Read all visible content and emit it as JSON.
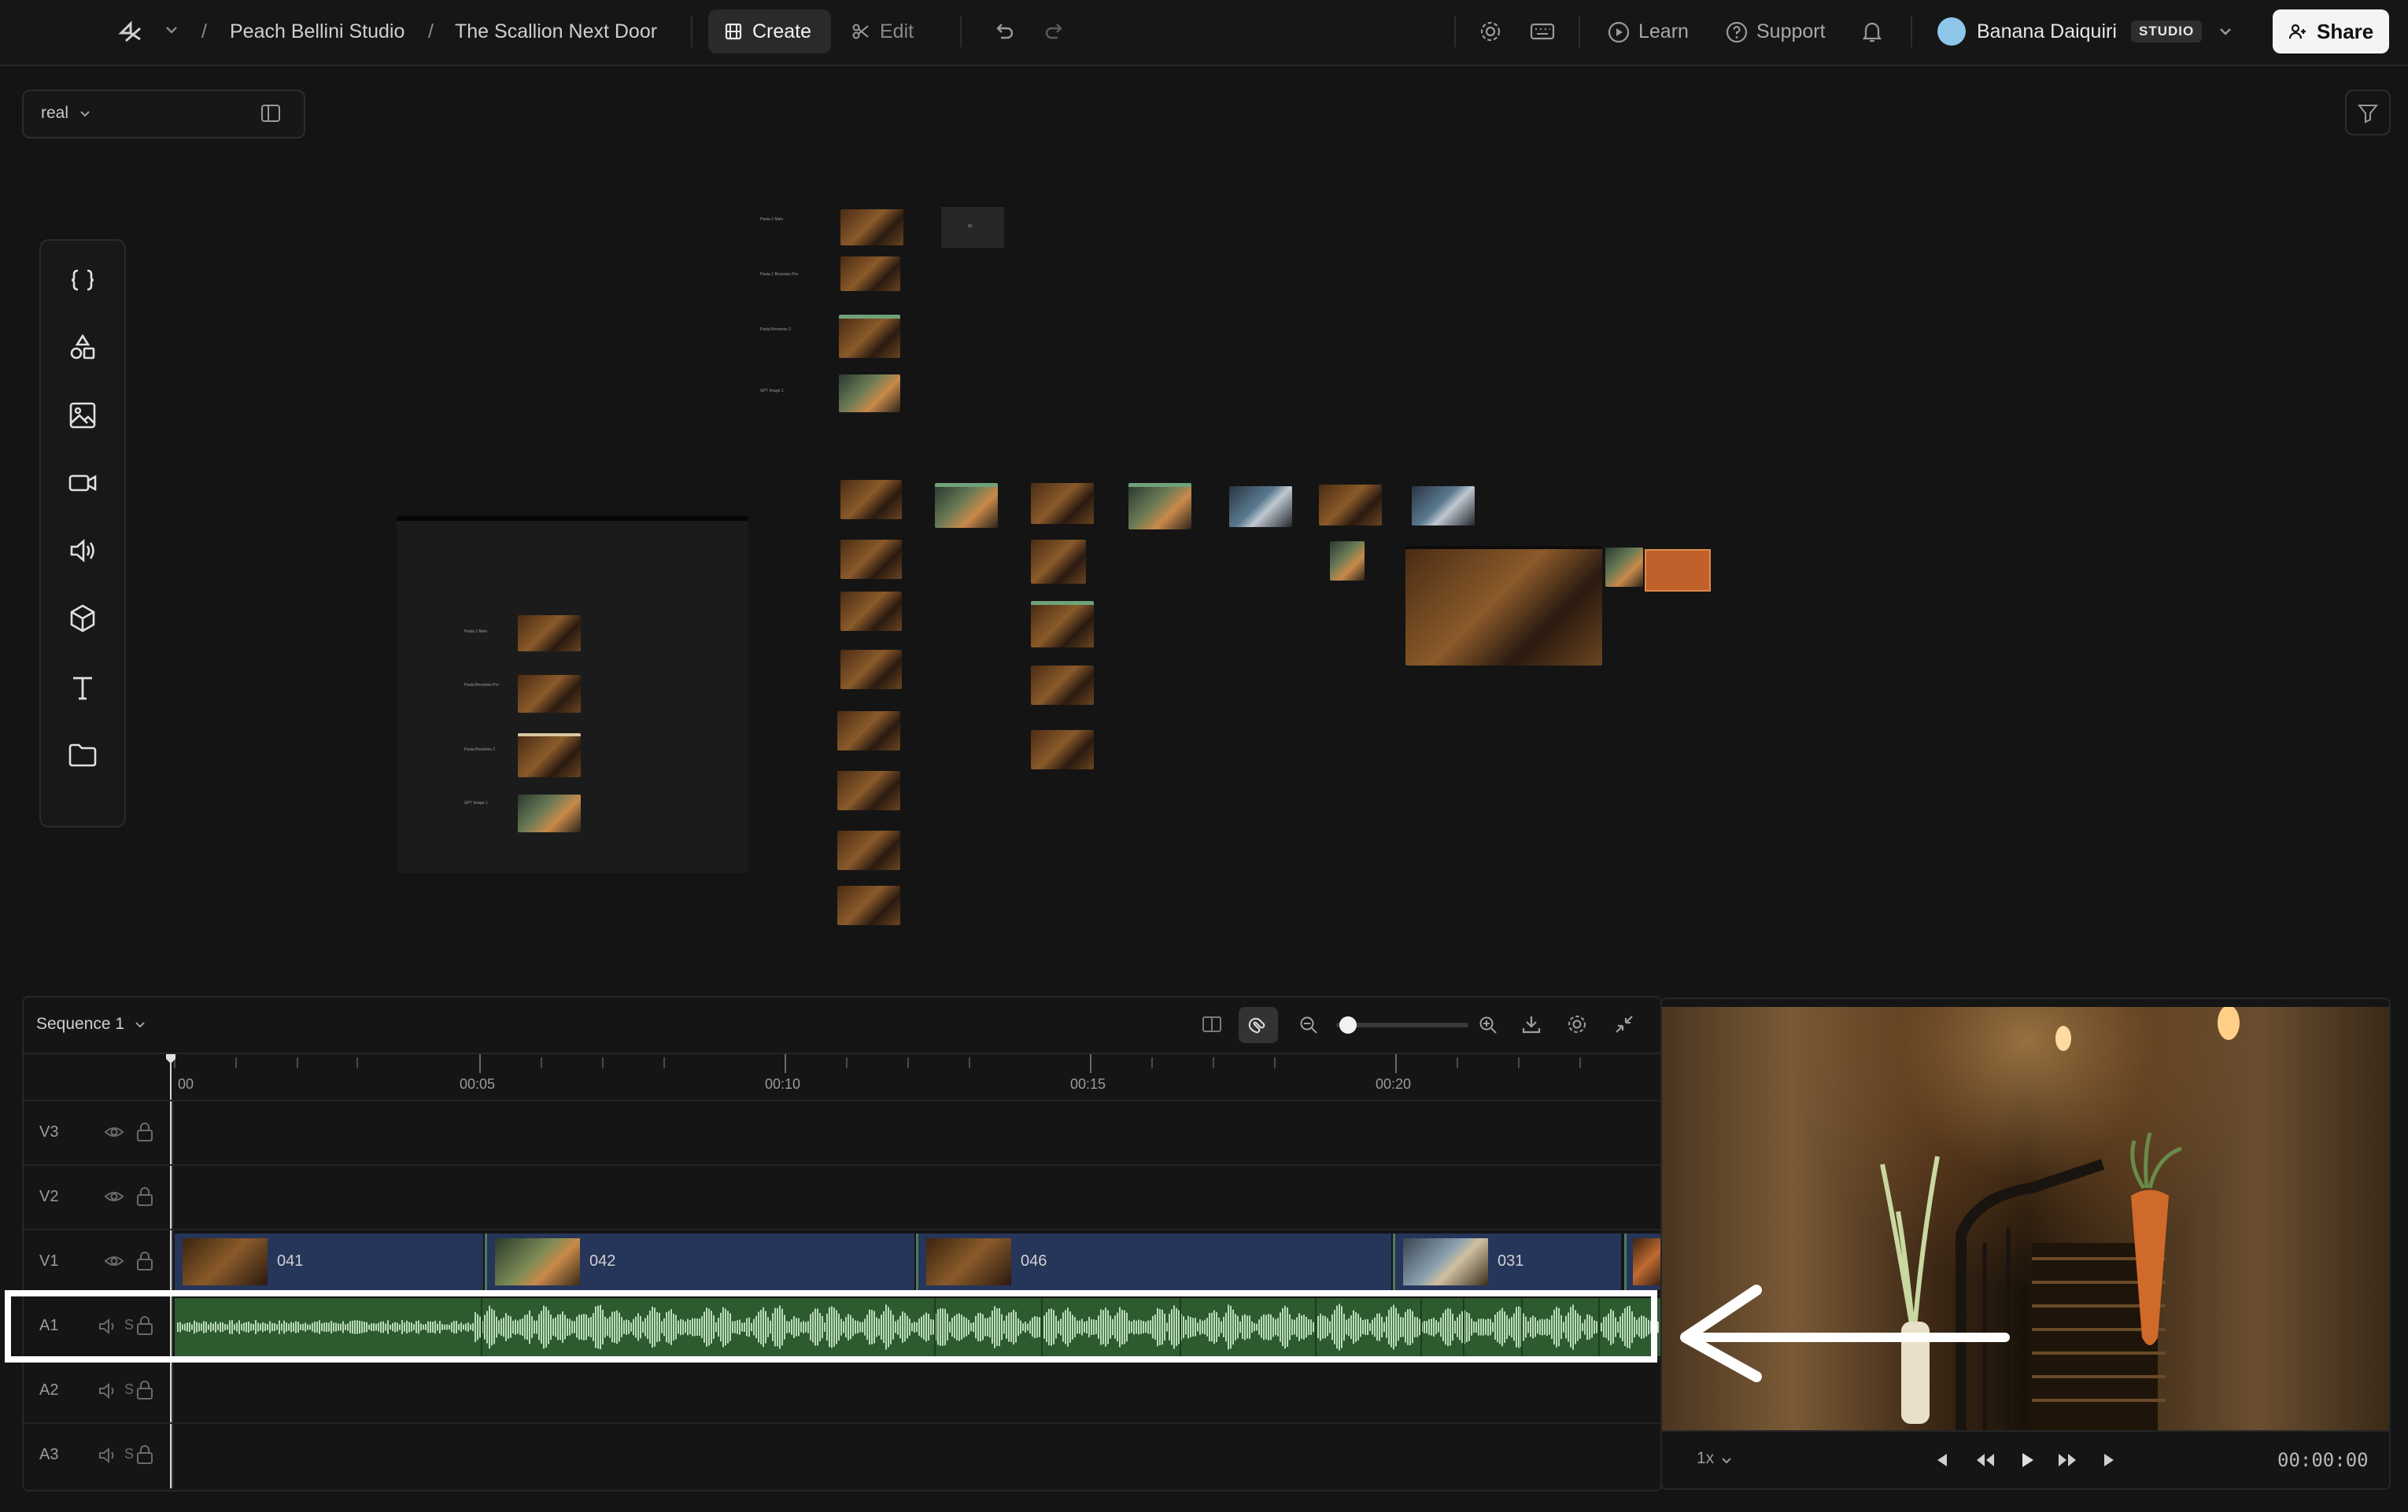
{
  "breadcrumb": {
    "workspace": "Peach Bellini Studio",
    "project": "The Scallion Next Door"
  },
  "tabs": [
    {
      "label": "Create"
    },
    {
      "label": "Edit"
    }
  ],
  "header": {
    "learn": "Learn",
    "support": "Support",
    "user_name": "Banana Daiquiri",
    "plan_badge": "STUDIO",
    "share": "Share"
  },
  "canvas": {
    "filter_label": "real",
    "nodes": {
      "main_a": "Pasta 1 Main",
      "main_b": "Pasta 1 Brownies Pro",
      "main_c": "Pasta Brownies 2",
      "main_d": "GPT Image 1",
      "main_box": "80",
      "group_a": "Pasta 1 Main",
      "group_b": "Pasta Brownies Pro",
      "group_c": "Pasta Brownies 2",
      "group_d": "GPT Image 1"
    }
  },
  "timeline": {
    "sequence_label": "Sequence 1",
    "zoom_level": 0.03,
    "ruler": [
      "00",
      "00:05",
      "00:10",
      "00:15",
      "00:20"
    ],
    "tracks": [
      {
        "id": "V3"
      },
      {
        "id": "V2"
      },
      {
        "id": "V1"
      },
      {
        "id": "A1"
      },
      {
        "id": "A2"
      },
      {
        "id": "A3"
      }
    ],
    "solo_label": "S",
    "clips": [
      {
        "name": "041"
      },
      {
        "name": "042"
      },
      {
        "name": "046"
      },
      {
        "name": "031"
      }
    ]
  },
  "preview": {
    "speed": "1x",
    "timecode": "00:00:00"
  },
  "colors": {
    "background": "#141414",
    "video_clip": "#26355a",
    "audio_clip": "#2d5a2f",
    "waveform": "#b9dcb9",
    "share_button": "#f4f4f4"
  }
}
